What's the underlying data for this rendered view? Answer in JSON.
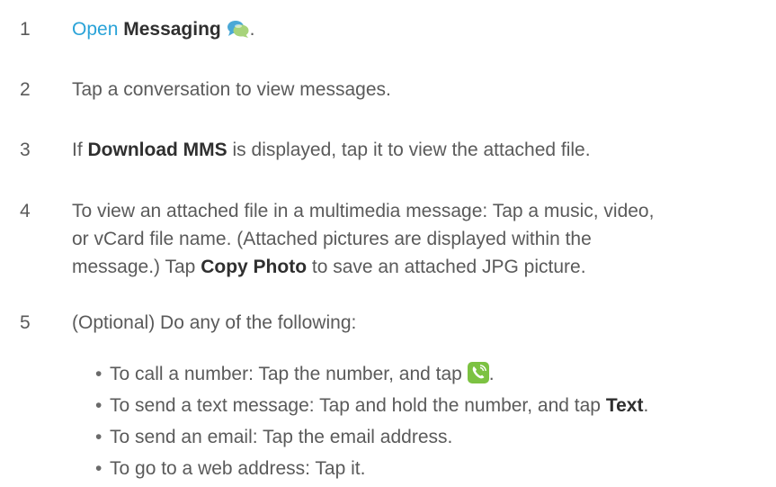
{
  "steps": [
    {
      "number": "1",
      "open_link": "Open",
      "app_name": "Messaging",
      "icon": "messaging-bubbles-icon",
      "end": "."
    },
    {
      "number": "2",
      "text": "Tap a conversation to view messages."
    },
    {
      "number": "3",
      "pre": "If",
      "bold": "Download MMS",
      "post": "is displayed, tap it to view the attached file."
    },
    {
      "number": "4",
      "line1": "To view an attached file in a multimedia message: Tap a music, video,",
      "line2": "or vCard file name. (Attached pictures are displayed within the",
      "line3_pre": "message.) Tap",
      "line3_bold": "Copy Photo",
      "line3_post": "to save an attached JPG picture."
    },
    {
      "number": "5",
      "text": "(Optional) Do any of the following:"
    }
  ],
  "bullets": [
    {
      "pre": "To call a number: Tap the number, and tap",
      "icon": "phone-call-icon",
      "post": "."
    },
    {
      "pre": "To send a text message: Tap and hold the number, and tap",
      "bold": "Text",
      "post": "."
    },
    {
      "text": "To send an email: Tap the email address."
    },
    {
      "text": "To go to a web address: Tap it."
    }
  ],
  "bullet_symbol": "•",
  "colors": {
    "text": "#5a5a5a",
    "bold": "#2f2f2f",
    "link": "#2aa3d8",
    "phone_icon_bg": "#7cc242"
  }
}
